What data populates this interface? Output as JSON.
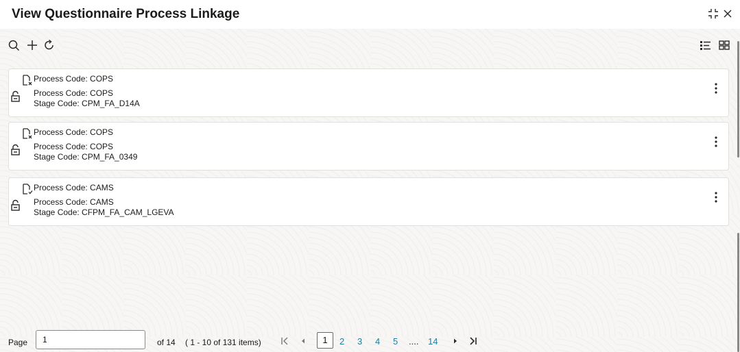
{
  "window": {
    "title": "View Questionnaire Process Linkage",
    "collapse_icon": "collapse-arrows-icon",
    "close_icon": "close-icon"
  },
  "toolbar": {
    "left_icons": [
      "search-icon",
      "add-icon",
      "refresh-icon"
    ],
    "right_icons": [
      "list-view-icon",
      "tile-view-icon"
    ]
  },
  "records": [
    {
      "header": "Process Code: COPS",
      "line1": "Process Code: COPS",
      "line2": "Stage Code: CPM_FA_D14A",
      "doc_icon": "document-unauthorized-icon",
      "lock_icon": "unlock-icon"
    },
    {
      "header": "Process Code: COPS",
      "line1": "Process Code: COPS",
      "line2": "Stage Code: CPM_FA_0349",
      "doc_icon": "document-unauthorized-icon",
      "lock_icon": "unlock-icon"
    },
    {
      "header": "Process Code: CAMS",
      "line1": "Process Code: CAMS",
      "line2": "Stage Code: CFPM_FA_CAM_LGEVA",
      "doc_icon": "document-authorized-icon",
      "lock_icon": "unlock-icon"
    }
  ],
  "pagination": {
    "page_label": "Page",
    "page_value": "1",
    "of_label": "of 14",
    "range_label": "( 1 - 10 of 131 items)",
    "pages": [
      "1",
      "2",
      "3",
      "4",
      "5",
      "....",
      "14"
    ],
    "current_page": "1"
  }
}
